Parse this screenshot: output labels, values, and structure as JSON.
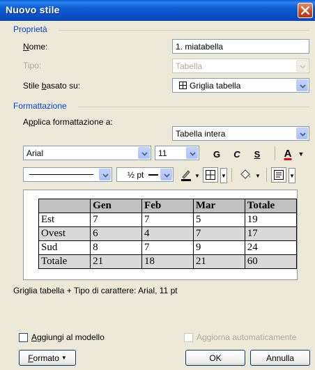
{
  "window": {
    "title": "Nuovo stile"
  },
  "properties": {
    "section_title": "Proprietà",
    "name_label": "Nome:",
    "name_value": "1. miatabella",
    "type_label": "Tipo:",
    "type_value": "Tabella",
    "based_on_label": "Stile basato su:",
    "based_on_value": "Griglia tabella",
    "based_on_icon": "table-grid-icon"
  },
  "formatting": {
    "section_title": "Formattazione",
    "apply_to_label": "Applica formattazione a:",
    "apply_to_value": "Tabella intera",
    "font": "Arial",
    "size": "11",
    "bold": "G",
    "italic": "C",
    "underline": "S",
    "font_color_letter": "A",
    "line_weight": "½ pt",
    "icons": [
      "pen-color-icon",
      "borders-icon",
      "fill-color-icon",
      "alignment-icon"
    ],
    "font_color_accent": "#ff0000"
  },
  "preview": {
    "headers": [
      "",
      "Gen",
      "Feb",
      "Mar",
      "Totale"
    ],
    "rows": [
      [
        "Est",
        "7",
        "7",
        "5",
        "19"
      ],
      [
        "Ovest",
        "6",
        "4",
        "7",
        "17"
      ],
      [
        "Sud",
        "8",
        "7",
        "9",
        "24"
      ],
      [
        "Totale",
        "21",
        "18",
        "21",
        "60"
      ]
    ]
  },
  "description": "Griglia tabella + Tipo di carattere: Arial, 11 pt",
  "footer": {
    "add_to_template": "Aggiungi al modello",
    "auto_update": "Aggiorna automaticamente",
    "format_button": "Formato",
    "ok_button": "OK",
    "cancel_button": "Annulla"
  }
}
